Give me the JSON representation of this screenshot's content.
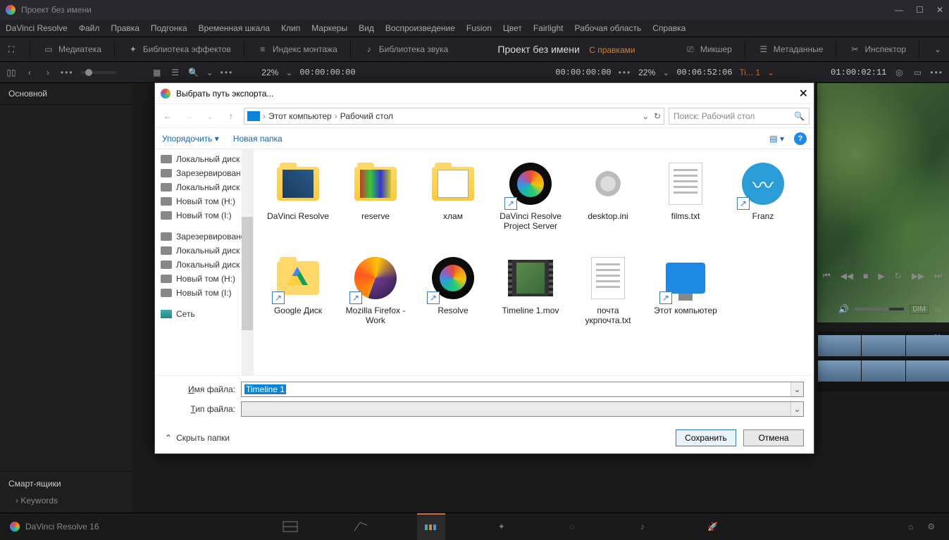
{
  "titlebar": {
    "title": "Проект без имени"
  },
  "menu": [
    "DaVinci Resolve",
    "Файл",
    "Правка",
    "Подгонка",
    "Временная шкала",
    "Клип",
    "Маркеры",
    "Вид",
    "Воспроизведение",
    "Fusion",
    "Цвет",
    "Fairlight",
    "Рабочая область",
    "Справка"
  ],
  "toolbar": {
    "mediateka": "Медиатека",
    "fxlib": "Библиотека эффектов",
    "editidx": "Индекс монтажа",
    "soundlib": "Библиотека звука",
    "project_title": "Проект без имени",
    "project_status": "С правками",
    "mixer": "Микшер",
    "metadata": "Метаданные",
    "inspector": "Инспектор"
  },
  "secondbar": {
    "zoom_left": "22%",
    "tc_left": "00:00:00:00",
    "tc_mid": "00:00:00:00",
    "zoom_right": "22%",
    "tc_dur": "00:06:52:06",
    "clipname": "Ti... 1",
    "tc_right": "01:00:02:11"
  },
  "leftpanel": {
    "main": "Основной",
    "smartbins": "Смарт-ящики",
    "keywords": "Keywords"
  },
  "player": {
    "dim": "DIM"
  },
  "strips": {
    "tick": "01:"
  },
  "bottombar": {
    "app": "DaVinci Resolve 16"
  },
  "dialog": {
    "title": "Выбрать путь экспорта...",
    "breadcrumb": [
      "Этот компьютер",
      "Рабочий стол"
    ],
    "search_placeholder": "Поиск: Рабочий стол",
    "organize": "Упорядочить",
    "newfolder": "Новая папка",
    "side": [
      "Локальный диск",
      "Зарезервирован",
      "Локальный диск",
      "Новый том (H:)",
      "Новый том (I:)",
      "Зарезервировано",
      "Локальный диск",
      "Локальный диск",
      "Новый том (H:)",
      "Новый том (I:)",
      "Сеть"
    ],
    "files": [
      {
        "name": "DaVinci Resolve",
        "type": "folder-resolve"
      },
      {
        "name": "reserve",
        "type": "folder-color"
      },
      {
        "name": "хлам",
        "type": "folder-docs"
      },
      {
        "name": "DaVinci Resolve Project Server",
        "type": "resolve",
        "shortcut": true
      },
      {
        "name": "desktop.ini",
        "type": "gear"
      },
      {
        "name": "films.txt",
        "type": "txt"
      },
      {
        "name": "Franz",
        "type": "franz",
        "shortcut": true
      },
      {
        "name": "Google Диск",
        "type": "gdrive",
        "shortcut": true
      },
      {
        "name": "Mozilla Firefox - Work",
        "type": "firefox",
        "shortcut": true
      },
      {
        "name": "Resolve",
        "type": "resolve",
        "shortcut": true
      },
      {
        "name": "Timeline 1.mov",
        "type": "video"
      },
      {
        "name": "почта укрпочта.txt",
        "type": "txt"
      },
      {
        "name": "Этот компьютер",
        "type": "monitor",
        "shortcut": true
      }
    ],
    "filename_label": "Имя файла:",
    "filename_value": "Timeline 1",
    "filetype_label": "Тип файла:",
    "filetype_value": "",
    "hide_folders": "Скрыть папки",
    "save": "Сохранить",
    "cancel": "Отмена"
  }
}
